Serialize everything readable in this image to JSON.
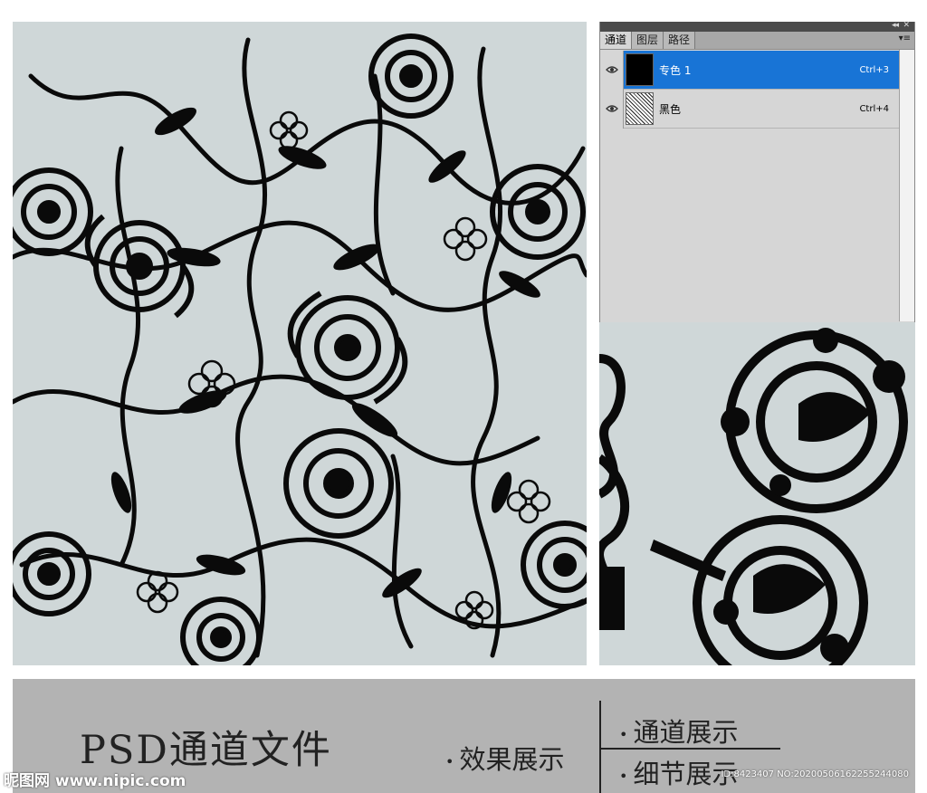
{
  "panel": {
    "tabs": [
      "通道",
      "图层",
      "路径"
    ],
    "collapse_glyph": "◂◂",
    "close_glyph": "✕",
    "menu_glyph": "▾≡",
    "channels": [
      {
        "name": "专色 1",
        "shortcut": "Ctrl+3",
        "selected": true
      },
      {
        "name": "黑色",
        "shortcut": "Ctrl+4",
        "selected": false
      }
    ]
  },
  "footer": {
    "title": "PSD通道文件",
    "item_effect": "效果展示",
    "item_channels": "通道展示",
    "item_detail": "细节展示",
    "bullet": "•"
  },
  "watermark": {
    "site": "昵图网 www.nipic.com",
    "id_text": "ID:8423407 NO:20200506162255244080"
  },
  "colors": {
    "pattern_bg": "#cfd7d8",
    "ink": "#0a0a0a",
    "selection": "#1874d6",
    "footer_bg": "#b3b3b3"
  }
}
